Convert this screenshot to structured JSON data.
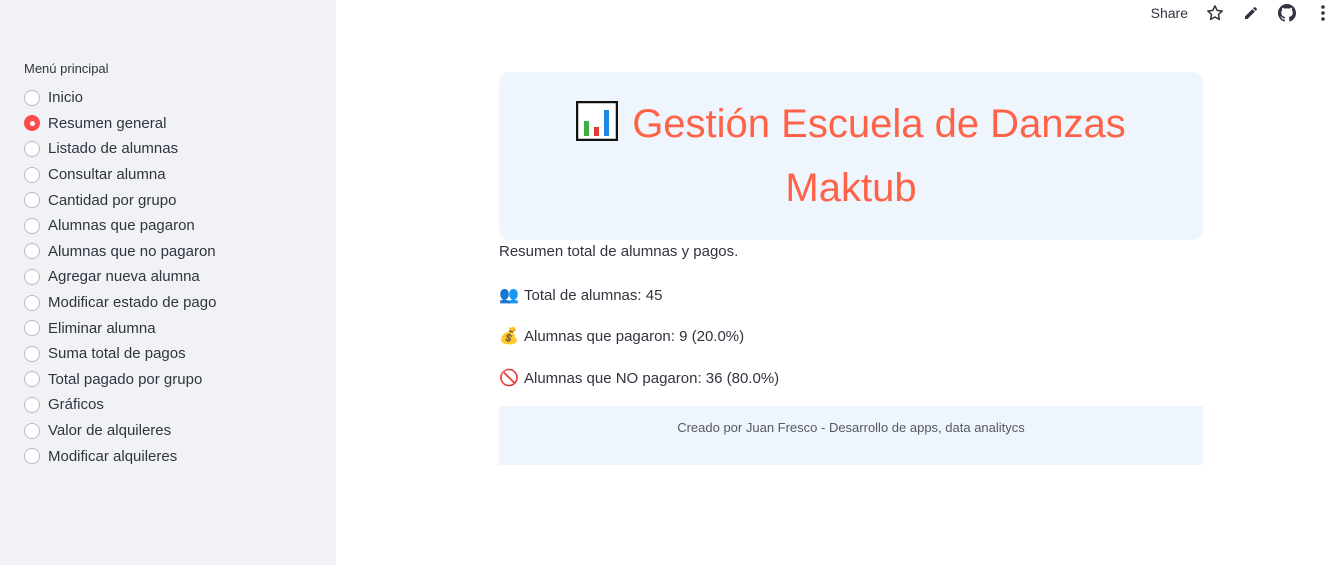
{
  "topbar": {
    "share_label": "Share"
  },
  "sidebar": {
    "menu_label": "Menú principal",
    "items": [
      {
        "label": "Inicio",
        "checked": false
      },
      {
        "label": "Resumen general",
        "checked": true
      },
      {
        "label": "Listado de alumnas",
        "checked": false
      },
      {
        "label": "Consultar alumna",
        "checked": false
      },
      {
        "label": "Cantidad por grupo",
        "checked": false
      },
      {
        "label": "Alumnas que pagaron",
        "checked": false
      },
      {
        "label": "Alumnas que no pagaron",
        "checked": false
      },
      {
        "label": "Agregar nueva alumna",
        "checked": false
      },
      {
        "label": "Modificar estado de pago",
        "checked": false
      },
      {
        "label": "Eliminar alumna",
        "checked": false
      },
      {
        "label": "Suma total de pagos",
        "checked": false
      },
      {
        "label": "Total pagado por grupo",
        "checked": false
      },
      {
        "label": "Gráficos",
        "checked": false
      },
      {
        "label": "Valor de alquileres",
        "checked": false
      },
      {
        "label": "Modificar alquileres",
        "checked": false
      }
    ]
  },
  "header": {
    "title_line1": "Gestión Escuela de Danzas",
    "title_line2": "Maktub",
    "icon": "bar-chart-icon"
  },
  "main": {
    "subtitle": "Resumen total de alumnas y pagos.",
    "total_text": "Total de alumnas: 45",
    "total_icon": "👥",
    "paid_text": "Alumnas que pagaron: 9 (20.0%)",
    "paid_icon": "💰",
    "unpaid_text": "Alumnas que NO pagaron: 36 (80.0%)",
    "unpaid_icon": "🚫"
  },
  "footer": {
    "text": "Creado por Juan Fresco - Desarrollo de apps, data analitycs"
  },
  "colors": {
    "accent": "#ff4b4b",
    "title": "#ff6347",
    "sidebar_bg": "#f0f2f6",
    "box_bg": "#eef5fd"
  }
}
